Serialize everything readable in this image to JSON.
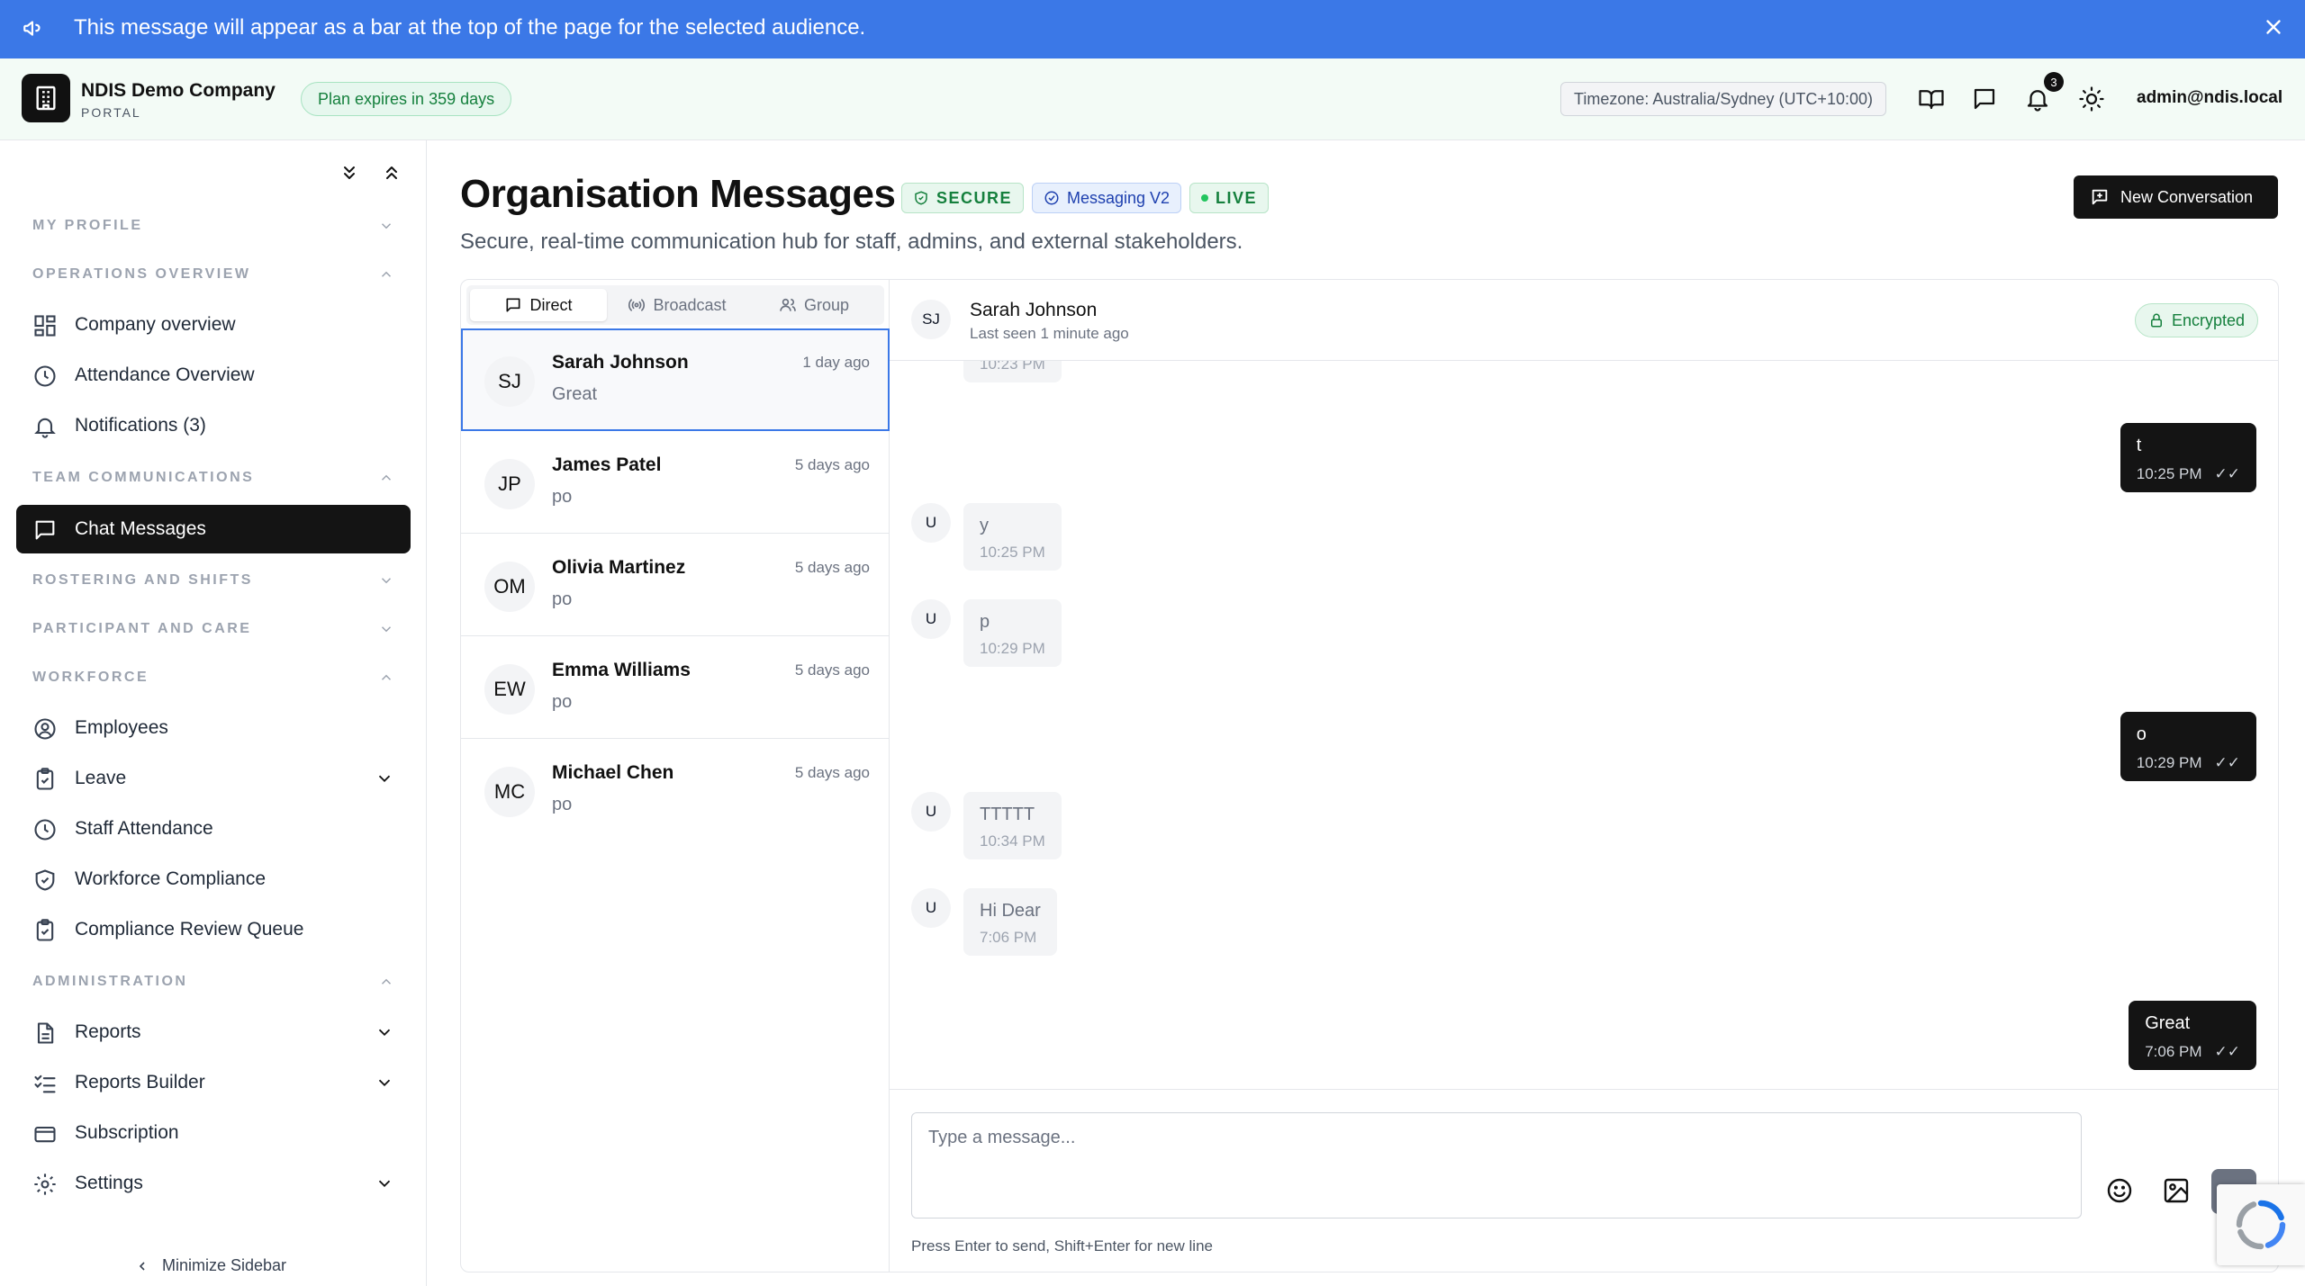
{
  "announcement": {
    "message": "This message will appear as a bar at the top of the page for the selected audience."
  },
  "header": {
    "company": "NDIS Demo Company",
    "portal": "PORTAL",
    "plan": "Plan expires in 359 days",
    "timezone": "Timezone: Australia/Sydney (UTC+10:00)",
    "notification_count": "3",
    "user": "admin@ndis.local"
  },
  "sidebar": {
    "sections": {
      "my_profile": "MY PROFILE",
      "operations": "OPERATIONS OVERVIEW",
      "team": "TEAM COMMUNICATIONS",
      "rostering": "ROSTERING AND SHIFTS",
      "participant": "PARTICIPANT AND CARE",
      "workforce": "WORKFORCE",
      "administration": "ADMINISTRATION"
    },
    "items": {
      "company_overview": "Company overview",
      "attendance_overview": "Attendance Overview",
      "notifications": "Notifications (3)",
      "chat_messages": "Chat Messages",
      "employees": "Employees",
      "leave": "Leave",
      "staff_attendance": "Staff Attendance",
      "workforce_compliance": "Workforce Compliance",
      "compliance_review": "Compliance Review Queue",
      "reports": "Reports",
      "reports_builder": "Reports Builder",
      "subscription": "Subscription",
      "settings": "Settings"
    },
    "minimize": "Minimize Sidebar"
  },
  "main": {
    "title": "Organisation Messages",
    "badges": {
      "secure": "SECURE",
      "v2": "Messaging V2",
      "live": "LIVE"
    },
    "new_conversation": "New Conversation",
    "subtitle": "Secure, real-time communication hub for staff, admins, and external stakeholders."
  },
  "tabs": {
    "direct": "Direct",
    "broadcast": "Broadcast",
    "group": "Group"
  },
  "conversations": [
    {
      "initials": "SJ",
      "name": "Sarah Johnson",
      "time": "1 day ago",
      "preview": "Great"
    },
    {
      "initials": "JP",
      "name": "James Patel",
      "time": "5 days ago",
      "preview": "po"
    },
    {
      "initials": "OM",
      "name": "Olivia Martinez",
      "time": "5 days ago",
      "preview": "po"
    },
    {
      "initials": "EW",
      "name": "Emma Williams",
      "time": "5 days ago",
      "preview": "po"
    },
    {
      "initials": "MC",
      "name": "Michael Chen",
      "time": "5 days ago",
      "preview": "po"
    }
  ],
  "chat": {
    "initials": "SJ",
    "name": "Sarah Johnson",
    "last_seen": "Last seen 1 minute ago",
    "encrypted": "Encrypted",
    "messages": [
      {
        "dir": "in",
        "avatar": "",
        "text": "",
        "time": "10:23 PM"
      },
      {
        "dir": "out",
        "text": "t",
        "time": "10:25 PM",
        "ticks": "✓✓"
      },
      {
        "dir": "in",
        "avatar": "U",
        "text": "y",
        "time": "10:25 PM"
      },
      {
        "dir": "in",
        "avatar": "U",
        "text": "p",
        "time": "10:29 PM"
      },
      {
        "dir": "out",
        "text": "o",
        "time": "10:29 PM",
        "ticks": "✓✓"
      },
      {
        "dir": "in",
        "avatar": "U",
        "text": "TTTTT",
        "time": "10:34 PM"
      },
      {
        "dir": "in",
        "avatar": "U",
        "text": "Hi Dear",
        "time": "7:06 PM"
      },
      {
        "dir": "out",
        "text": "Great",
        "time": "7:06 PM",
        "ticks": "✓✓"
      }
    ],
    "placeholder": "Type a message...",
    "hint": "Press Enter to send, Shift+Enter for new line"
  },
  "colors": {
    "announcement": "#3b78e7",
    "accent_dark": "#141414",
    "success": "#15803d",
    "selected_border": "#3b78e7"
  }
}
